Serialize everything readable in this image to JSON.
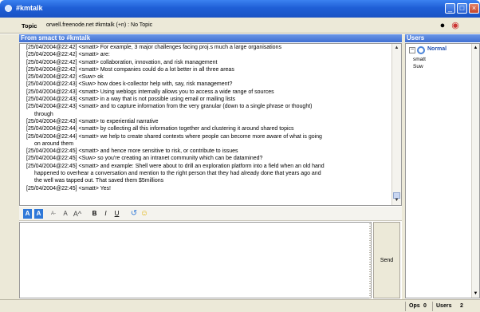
{
  "window": {
    "title": "#kmtalk",
    "buttons": {
      "minimize": "_",
      "maximize": "□",
      "close": "×"
    }
  },
  "topic": {
    "label": "Topic",
    "value": "orwell.freenode.net #kmtalk (+n) : No Topic"
  },
  "chat": {
    "header": "From smact to #kmtalk",
    "lines": [
      {
        "text": "[25/04/2004@22:42] <smatt> For example, 3 major challenges facing proj.s much a large organisations",
        "cont": false
      },
      {
        "text": "[25/04/2004@22:42] <smatt> are:",
        "cont": false
      },
      {
        "text": "[25/04/2004@22:42] <smatt> collaboration, innovation, and risk management",
        "cont": false
      },
      {
        "text": "[25/04/2004@22:42] <smatt> Most companies could do a lot better in all three areas",
        "cont": false
      },
      {
        "text": "[25/04/2004@22:42] <Suw> ok",
        "cont": false
      },
      {
        "text": "[25/04/2004@22:43] <Suw> how does k-collector help with, say, risk management?",
        "cont": false
      },
      {
        "text": "[25/04/2004@22:43] <smatt> Using weblogs internally allows you to access a wide range of sources",
        "cont": false
      },
      {
        "text": "[25/04/2004@22:43] <smatt> in a way that is not possible using email or mailing lists",
        "cont": false
      },
      {
        "text": "[25/04/2004@22:43] <smatt> and to capture information from the very granular (down to a single phrase or thought)",
        "cont": false
      },
      {
        "text": "through",
        "cont": true
      },
      {
        "text": "[25/04/2004@22:43] <smatt> to experiential narrative",
        "cont": false
      },
      {
        "text": "[25/04/2004@22:44] <smatt> by collecting all this information together and clustering it around shared topics",
        "cont": false
      },
      {
        "text": "[25/04/2004@22:44] <smatt> we help to create shared contexts where people can become more aware of what is going",
        "cont": false
      },
      {
        "text": "on around them",
        "cont": true
      },
      {
        "text": "[25/04/2004@22:45] <smatt> and hence more sensitive to risk, or contribute to issues",
        "cont": false
      },
      {
        "text": "[25/04/2004@22:45] <Suw> so you're creating an intranet community which can be datamined?",
        "cont": false
      },
      {
        "text": "[25/04/2004@22:45] <smatt> and example: Shell were about to drill an exploration platform into a field when an old hand",
        "cont": false
      },
      {
        "text": "happened to overhear a conversation and mention to the right person that they had already done that years ago and",
        "cont": true
      },
      {
        "text": "the well was tapped out. That saved them $5millions",
        "cont": true
      },
      {
        "text": "[25/04/2004@22:45] <smatt> Yes!",
        "cont": false
      }
    ]
  },
  "format_toolbar": {
    "text_color": "A",
    "bg_color": "A",
    "font_smaller": "A-",
    "font_normal": "A",
    "font_larger": "A^",
    "bold": "B",
    "italic": "I",
    "underline": "U"
  },
  "input": {
    "value": "",
    "send_label": "Send"
  },
  "users": {
    "header": "Users",
    "group_toggle": "−",
    "group": "Normal",
    "items": [
      "smatt",
      "Suw"
    ]
  },
  "status": {
    "ops_label": "Ops",
    "ops_count": "0",
    "users_label": "Users",
    "users_count": "2"
  },
  "colors": {
    "title_bar": "#1f5fd6",
    "panel_header": "#3f6fd2",
    "chrome": "#ece9d8"
  }
}
